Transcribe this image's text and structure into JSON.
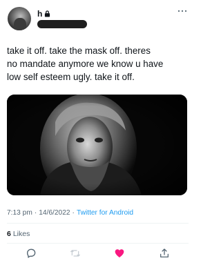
{
  "header": {
    "display_name": "h",
    "more_icon": "more-horizontal-icon",
    "lock_icon": "lock-icon"
  },
  "tweet": {
    "text": "take it off. take the mask off. theres\nno mandate anymore we know u have\nlow self esteem ugly. take it off.",
    "time": "7:13 pm",
    "date": "14/6/2022",
    "separator": "·",
    "source": "Twitter for Android"
  },
  "stats": {
    "likes_count": "6",
    "likes_label": "Likes"
  },
  "actions": {
    "reply_icon": "reply-icon",
    "retweet_icon": "retweet-icon",
    "like_icon": "heart-filled-icon",
    "share_icon": "share-icon"
  },
  "colors": {
    "text": "#0f1419",
    "secondary": "#536471",
    "link": "#1d9bf0",
    "like": "#f91880"
  }
}
